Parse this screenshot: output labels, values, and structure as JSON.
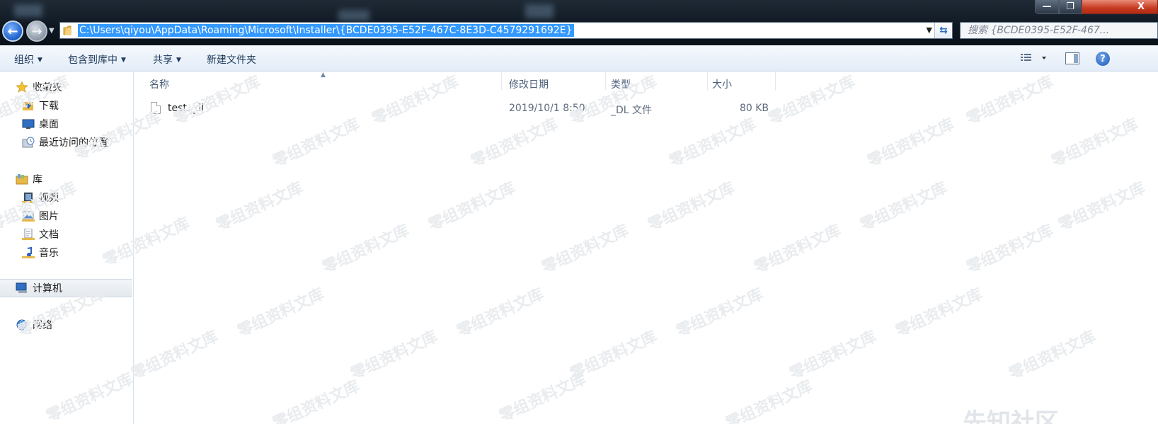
{
  "address_bar": {
    "path": "C:\\Users\\qiyou\\AppData\\Roaming\\Microsoft\\Installer\\{BCDE0395-E52F-467C-8E3D-C4579291692E}",
    "search_placeholder": "搜索 {BCDE0395-E52F-467... ",
    "refresh_glyph": "⇆"
  },
  "window_controls": {
    "minimize": "—",
    "maximize": "❐",
    "close": "X"
  },
  "command_bar": {
    "organize": "组织",
    "include_in_library": "包含到库中",
    "share": "共享",
    "new_folder": "新建文件夹",
    "help": "?"
  },
  "nav": {
    "favorites": {
      "label": "收藏夹",
      "items": [
        "下载",
        "桌面",
        "最近访问的位置"
      ]
    },
    "libraries": {
      "label": "库",
      "items": [
        "视频",
        "图片",
        "文档",
        "音乐"
      ]
    },
    "computer": "计算机",
    "network": "网络"
  },
  "columns": {
    "name": "名称",
    "modified": "修改日期",
    "type": "类型",
    "size": "大小"
  },
  "files": [
    {
      "name": "test._dl",
      "modified": "2019/10/1 8:50",
      "type": "_DL 文件",
      "size": "80 KB"
    }
  ],
  "watermark": {
    "text": "零组资料文库",
    "logo": "先知社区"
  },
  "colors": {
    "selection": "#3399ff",
    "titlebar": "#0f1821",
    "close_button": "#c63a20",
    "command_text": "#1e395b"
  }
}
